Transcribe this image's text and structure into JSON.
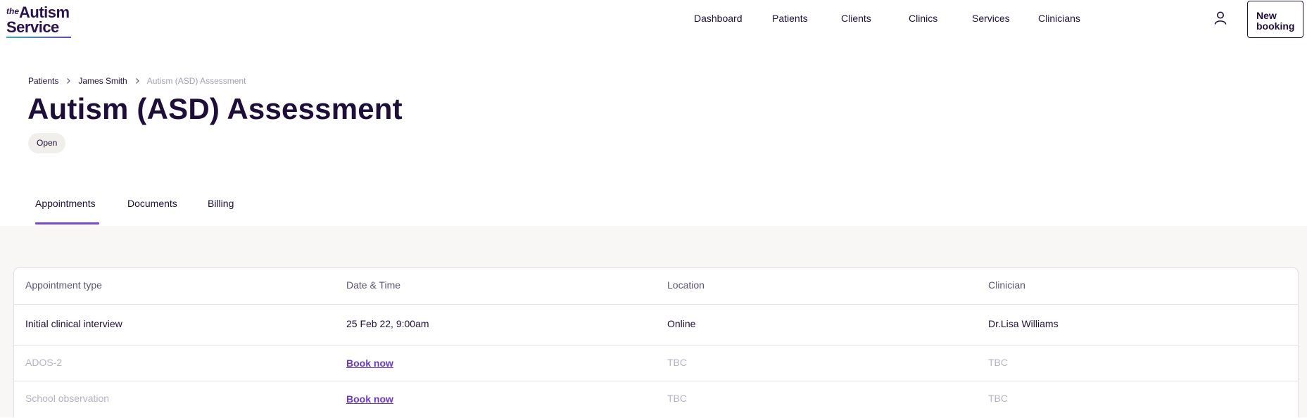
{
  "logo": {
    "prefix": "the",
    "line1": "Autism",
    "line2": "Service"
  },
  "nav": {
    "items": [
      {
        "label": "Dashboard"
      },
      {
        "label": "Patients"
      },
      {
        "label": "Clients"
      },
      {
        "label": "Clinics"
      },
      {
        "label": "Services"
      },
      {
        "label": "Clinicians"
      }
    ],
    "account_icon": "user-icon",
    "new_booking": {
      "line1": "New",
      "line2": "booking"
    }
  },
  "breadcrumb": {
    "items": [
      "Patients",
      "James Smith"
    ],
    "current": "Autism (ASD) Assessment",
    "separator_icon": "chevron-right-icon"
  },
  "page": {
    "title": "Autism (ASD) Assessment",
    "status": "Open"
  },
  "tabs": [
    {
      "label": "Appointments",
      "active": true
    },
    {
      "label": "Documents",
      "active": false
    },
    {
      "label": "Billing",
      "active": false
    }
  ],
  "table": {
    "columns": [
      "Appointment type",
      "Date & Time",
      "Location",
      "Clinician"
    ],
    "rows": [
      {
        "type": "Initial clinical interview",
        "datetime": "25 Feb 22, 9:00am",
        "location": "Online",
        "clinician": "Dr.Lisa Williams"
      },
      {
        "type": "ADOS-2",
        "datetime": "Book now",
        "location": "TBC",
        "clinician": "TBC"
      },
      {
        "type": "School observation",
        "datetime": "Book now",
        "location": "TBC",
        "clinician": "TBC"
      }
    ]
  },
  "colors": {
    "primary_text": "#1e0f3a",
    "accent": "#7a44d6",
    "link": "#6b35d0",
    "muted": "#b7b2c2",
    "page_bg": "#f8f7f5"
  }
}
